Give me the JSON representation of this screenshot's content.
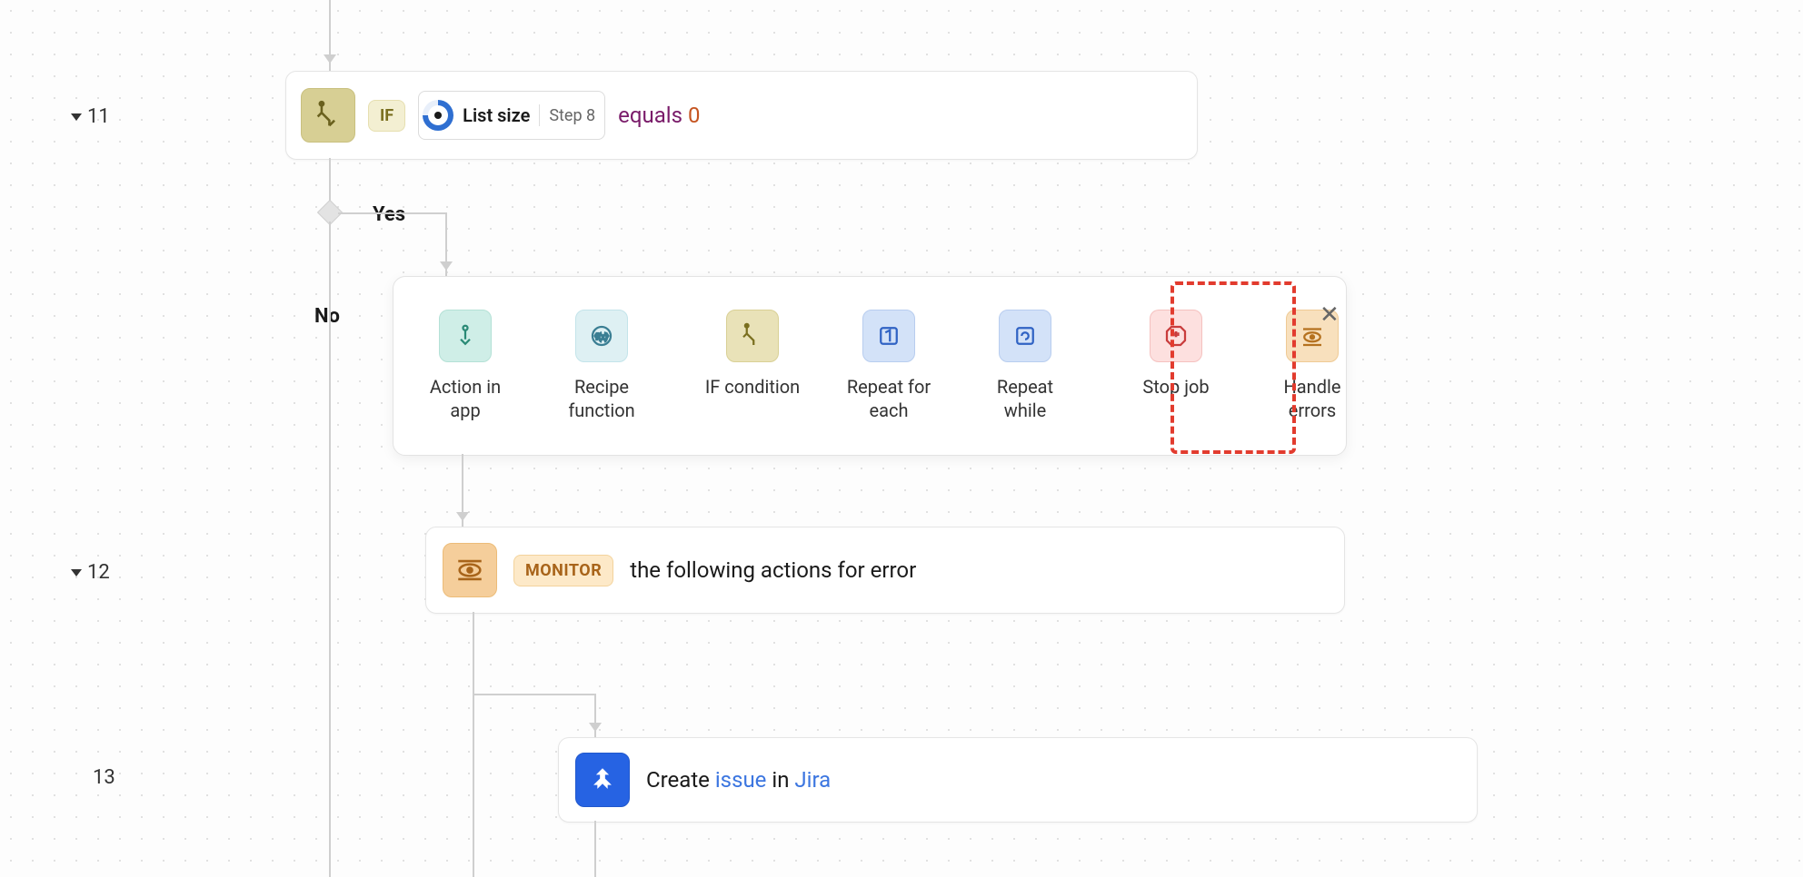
{
  "steps": {
    "s11": {
      "num": "11",
      "badge": "IF",
      "pill_label": "List size",
      "pill_step": "Step 8",
      "op": "equals",
      "val": "0"
    },
    "s12": {
      "num": "12",
      "badge": "MONITOR",
      "desc": "the following actions for error"
    },
    "s13": {
      "num": "13",
      "verb": "Create ",
      "obj": "issue",
      "mid": " in ",
      "app": "Jira"
    }
  },
  "branches": {
    "yes": "Yes",
    "no": "No"
  },
  "picker": {
    "action_in_app": "Action in app",
    "recipe_function": "Recipe function",
    "if_condition": "IF condition",
    "repeat_for_each": "Repeat for each",
    "repeat_while": "Repeat while",
    "stop_job": "Stop job",
    "handle_errors": "Handle errors"
  }
}
